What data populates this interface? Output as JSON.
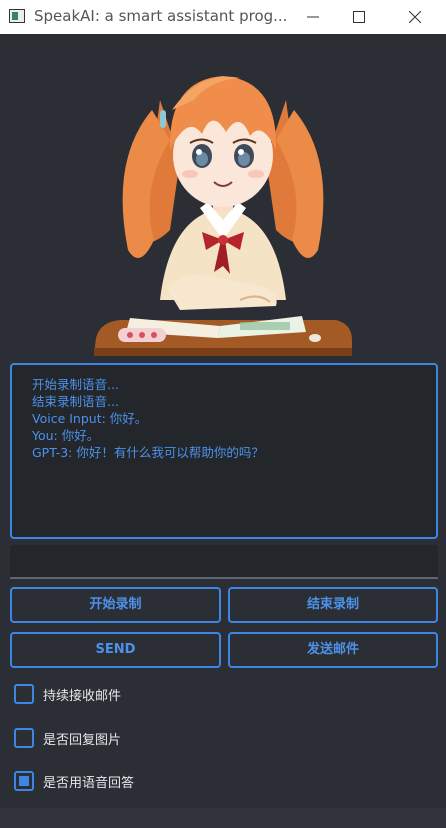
{
  "window": {
    "title": "SpeakAI: a smart assistant prog..."
  },
  "log": {
    "lines": [
      "开始录制语音...",
      "结束录制语音...",
      "Voice Input: 你好。",
      "You: 你好。",
      "GPT-3: 你好！有什么我可以帮助你的吗？"
    ]
  },
  "input": {
    "value": "",
    "placeholder": ""
  },
  "buttons": {
    "start_record": "开始录制",
    "stop_record": "结束录制",
    "send": "SEND",
    "send_mail": "发送邮件"
  },
  "options": [
    {
      "label": "持续接收邮件",
      "checked": false
    },
    {
      "label": "是否回复图片",
      "checked": false
    },
    {
      "label": "是否用语音回答",
      "checked": true
    }
  ],
  "colors": {
    "accent": "#3d86e6",
    "background": "#2b2e34",
    "panel": "#23262b",
    "text": "#e4e7ec"
  }
}
